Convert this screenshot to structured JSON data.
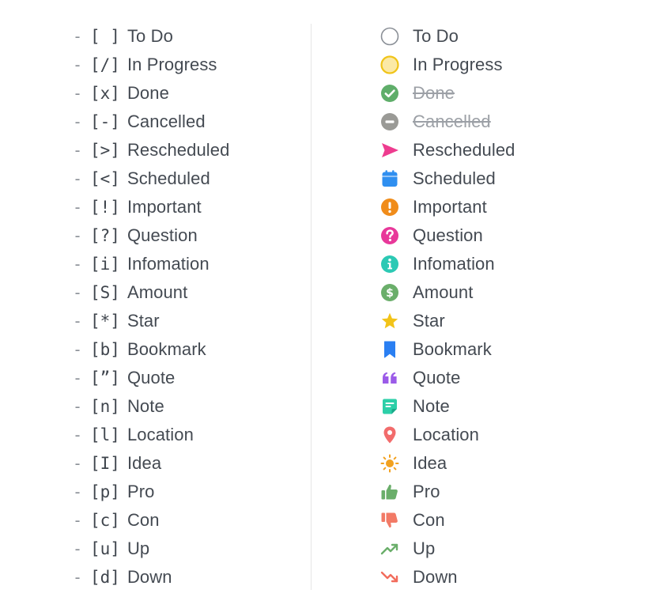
{
  "colors": {
    "todo": "#8a8f96",
    "in_progress": "#f5d33a",
    "done": "#5fae6a",
    "cancelled": "#9a9a96",
    "rescheduled": "#ee3c8f",
    "scheduled": "#2f8ff0",
    "important": "#f08c1a",
    "question": "#e8389a",
    "information": "#2cc9b4",
    "amount": "#6aae6a",
    "star": "#f2c318",
    "bookmark": "#2a7ff2",
    "quote": "#9b5be8",
    "note": "#2ccfa8",
    "location": "#f26c6c",
    "idea": "#f2a11f",
    "pro": "#6aae6a",
    "con": "#f27a66",
    "up": "#6aae6a",
    "down": "#f26c5c"
  },
  "left": {
    "dash": "-",
    "items": [
      {
        "syntax": "[ ]",
        "label": "To Do"
      },
      {
        "syntax": "[/]",
        "label": "In Progress"
      },
      {
        "syntax": "[x]",
        "label": "Done"
      },
      {
        "syntax": "[-]",
        "label": "Cancelled"
      },
      {
        "syntax": "[>]",
        "label": "Rescheduled"
      },
      {
        "syntax": "[<]",
        "label": "Scheduled"
      },
      {
        "syntax": "[!]",
        "label": "Important"
      },
      {
        "syntax": "[?]",
        "label": "Question"
      },
      {
        "syntax": "[i]",
        "label": "Infomation"
      },
      {
        "syntax": "[S]",
        "label": "Amount"
      },
      {
        "syntax": "[*]",
        "label": "Star"
      },
      {
        "syntax": "[b]",
        "label": "Bookmark"
      },
      {
        "syntax": "[”]",
        "label": "Quote"
      },
      {
        "syntax": "[n]",
        "label": "Note"
      },
      {
        "syntax": "[l]",
        "label": "Location"
      },
      {
        "syntax": "[I]",
        "label": "Idea"
      },
      {
        "syntax": "[p]",
        "label": "Pro"
      },
      {
        "syntax": "[c]",
        "label": "Con"
      },
      {
        "syntax": "[u]",
        "label": "Up"
      },
      {
        "syntax": "[d]",
        "label": "Down"
      }
    ]
  },
  "right": {
    "items": [
      {
        "icon": "empty-circle-icon",
        "label": "To Do"
      },
      {
        "icon": "half-filled-circle-icon",
        "label": "In Progress"
      },
      {
        "icon": "check-circle-icon",
        "label": "Done"
      },
      {
        "icon": "minus-circle-icon",
        "label": "Cancelled"
      },
      {
        "icon": "paper-plane-icon",
        "label": "Rescheduled"
      },
      {
        "icon": "calendar-icon",
        "label": "Scheduled"
      },
      {
        "icon": "exclamation-circle-icon",
        "label": "Important"
      },
      {
        "icon": "question-circle-icon",
        "label": "Question"
      },
      {
        "icon": "info-circle-icon",
        "label": "Infomation"
      },
      {
        "icon": "dollar-circle-icon",
        "label": "Amount"
      },
      {
        "icon": "star-icon",
        "label": "Star"
      },
      {
        "icon": "bookmark-icon",
        "label": "Bookmark"
      },
      {
        "icon": "quote-icon",
        "label": "Quote"
      },
      {
        "icon": "note-icon",
        "label": "Note"
      },
      {
        "icon": "location-pin-icon",
        "label": "Location"
      },
      {
        "icon": "lightbulb-sun-icon",
        "label": "Idea"
      },
      {
        "icon": "thumbs-up-icon",
        "label": "Pro"
      },
      {
        "icon": "thumbs-down-icon",
        "label": "Con"
      },
      {
        "icon": "trend-up-icon",
        "label": "Up"
      },
      {
        "icon": "trend-down-icon",
        "label": "Down"
      }
    ]
  }
}
